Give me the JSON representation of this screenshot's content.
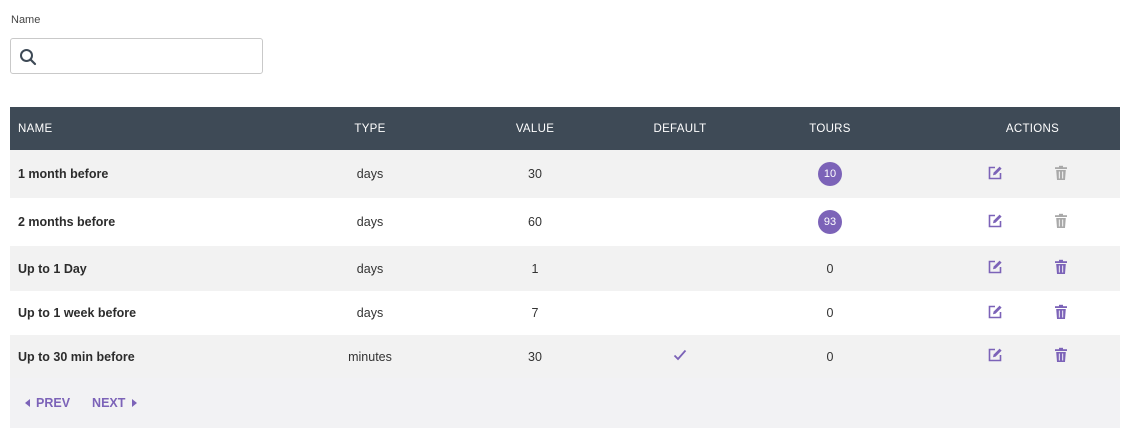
{
  "filter": {
    "label": "Name",
    "placeholder": "",
    "value": ""
  },
  "table": {
    "headers": {
      "name": "NAME",
      "type": "TYPE",
      "value": "VALUE",
      "default": "DEFAULT",
      "tours": "TOURS",
      "actions": "ACTIONS"
    },
    "rows": [
      {
        "name": "1 month before",
        "type": "days",
        "value": "30",
        "default": false,
        "tours": "10",
        "tours_badge": true,
        "delete_enabled": false
      },
      {
        "name": "2 months before",
        "type": "days",
        "value": "60",
        "default": false,
        "tours": "93",
        "tours_badge": true,
        "delete_enabled": false
      },
      {
        "name": "Up to 1 Day",
        "type": "days",
        "value": "1",
        "default": false,
        "tours": "0",
        "tours_badge": false,
        "delete_enabled": true
      },
      {
        "name": "Up to 1 week before",
        "type": "days",
        "value": "7",
        "default": false,
        "tours": "0",
        "tours_badge": false,
        "delete_enabled": true
      },
      {
        "name": "Up to 30 min before",
        "type": "minutes",
        "value": "30",
        "default": true,
        "tours": "0",
        "tours_badge": false,
        "delete_enabled": true
      }
    ]
  },
  "pagination": {
    "prev_label": "PREV",
    "next_label": "NEXT"
  },
  "colors": {
    "header_bg": "#3e4a56",
    "accent": "#7c63b8",
    "disabled": "#a9a9a9"
  },
  "icons": {
    "search": "search-icon",
    "edit": "edit-icon",
    "delete": "trash-icon",
    "default_check": "check-icon",
    "prev": "caret-left-icon",
    "next": "caret-right-icon"
  }
}
